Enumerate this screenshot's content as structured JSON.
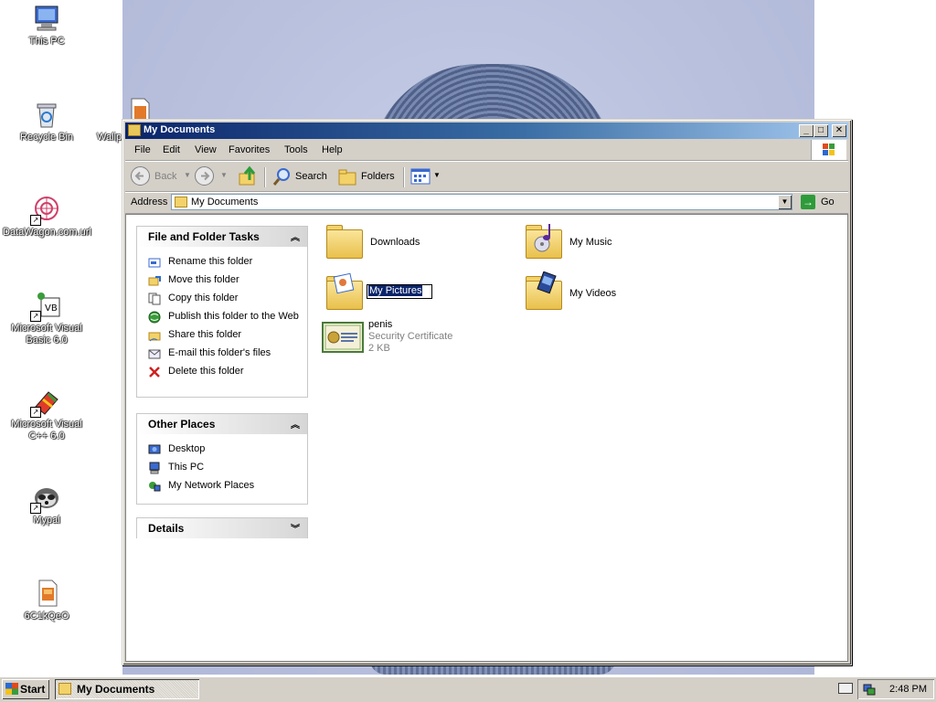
{
  "desktop": {
    "icons": [
      {
        "label": "This PC",
        "icon": "computer-icon"
      },
      {
        "label": "Recycle Bin",
        "icon": "recycle-bin-icon"
      },
      {
        "label": "DataWagon.com.url",
        "icon": "internet-shortcut-icon"
      },
      {
        "label": "Microsoft Visual Basic 6.0",
        "icon": "visual-basic-icon"
      },
      {
        "label": "Microsoft Visual C++ 6.0",
        "icon": "visual-cpp-icon"
      },
      {
        "label": "Mypal",
        "icon": "mypal-browser-icon"
      },
      {
        "label": "6C1kQeO",
        "icon": "file-icon"
      },
      {
        "label": "Wallp",
        "icon": "file-icon"
      }
    ]
  },
  "window": {
    "title": "My Documents",
    "buttons": {
      "minimize": "_",
      "maximize": "□",
      "close": "✕"
    },
    "menu": [
      "File",
      "Edit",
      "View",
      "Favorites",
      "Tools",
      "Help"
    ],
    "toolbar": {
      "back": "Back",
      "search": "Search",
      "folders": "Folders"
    },
    "address": {
      "label": "Address",
      "value": "My Documents",
      "go": "Go"
    }
  },
  "task_pane": {
    "file_folder_tasks": {
      "title": "File and Folder Tasks",
      "items": [
        {
          "label": "Rename this folder",
          "icon": "rename-icon"
        },
        {
          "label": "Move this folder",
          "icon": "move-icon"
        },
        {
          "label": "Copy this folder",
          "icon": "copy-icon"
        },
        {
          "label": "Publish this folder to the Web",
          "icon": "publish-web-icon"
        },
        {
          "label": "Share this folder",
          "icon": "share-icon"
        },
        {
          "label": "E-mail this folder's files",
          "icon": "email-icon"
        },
        {
          "label": "Delete this folder",
          "icon": "delete-icon"
        }
      ]
    },
    "other_places": {
      "title": "Other Places",
      "items": [
        {
          "label": "Desktop",
          "icon": "desktop-icon"
        },
        {
          "label": "This PC",
          "icon": "computer-icon"
        },
        {
          "label": "My Network Places",
          "icon": "network-icon"
        }
      ]
    },
    "details": {
      "title": "Details"
    }
  },
  "files": [
    {
      "name": "Downloads",
      "icon": "folder-icon"
    },
    {
      "name": "My Music",
      "icon": "music-folder-icon"
    },
    {
      "name": "My Pictures",
      "icon": "pictures-folder-icon",
      "renaming": true
    },
    {
      "name": "My Videos",
      "icon": "videos-folder-icon"
    },
    {
      "name": "penis",
      "type": "Security Certificate",
      "size": "2 KB",
      "icon": "certificate-icon"
    }
  ],
  "taskbar": {
    "start": "Start",
    "task": "My Documents",
    "clock": "2:48 PM"
  }
}
